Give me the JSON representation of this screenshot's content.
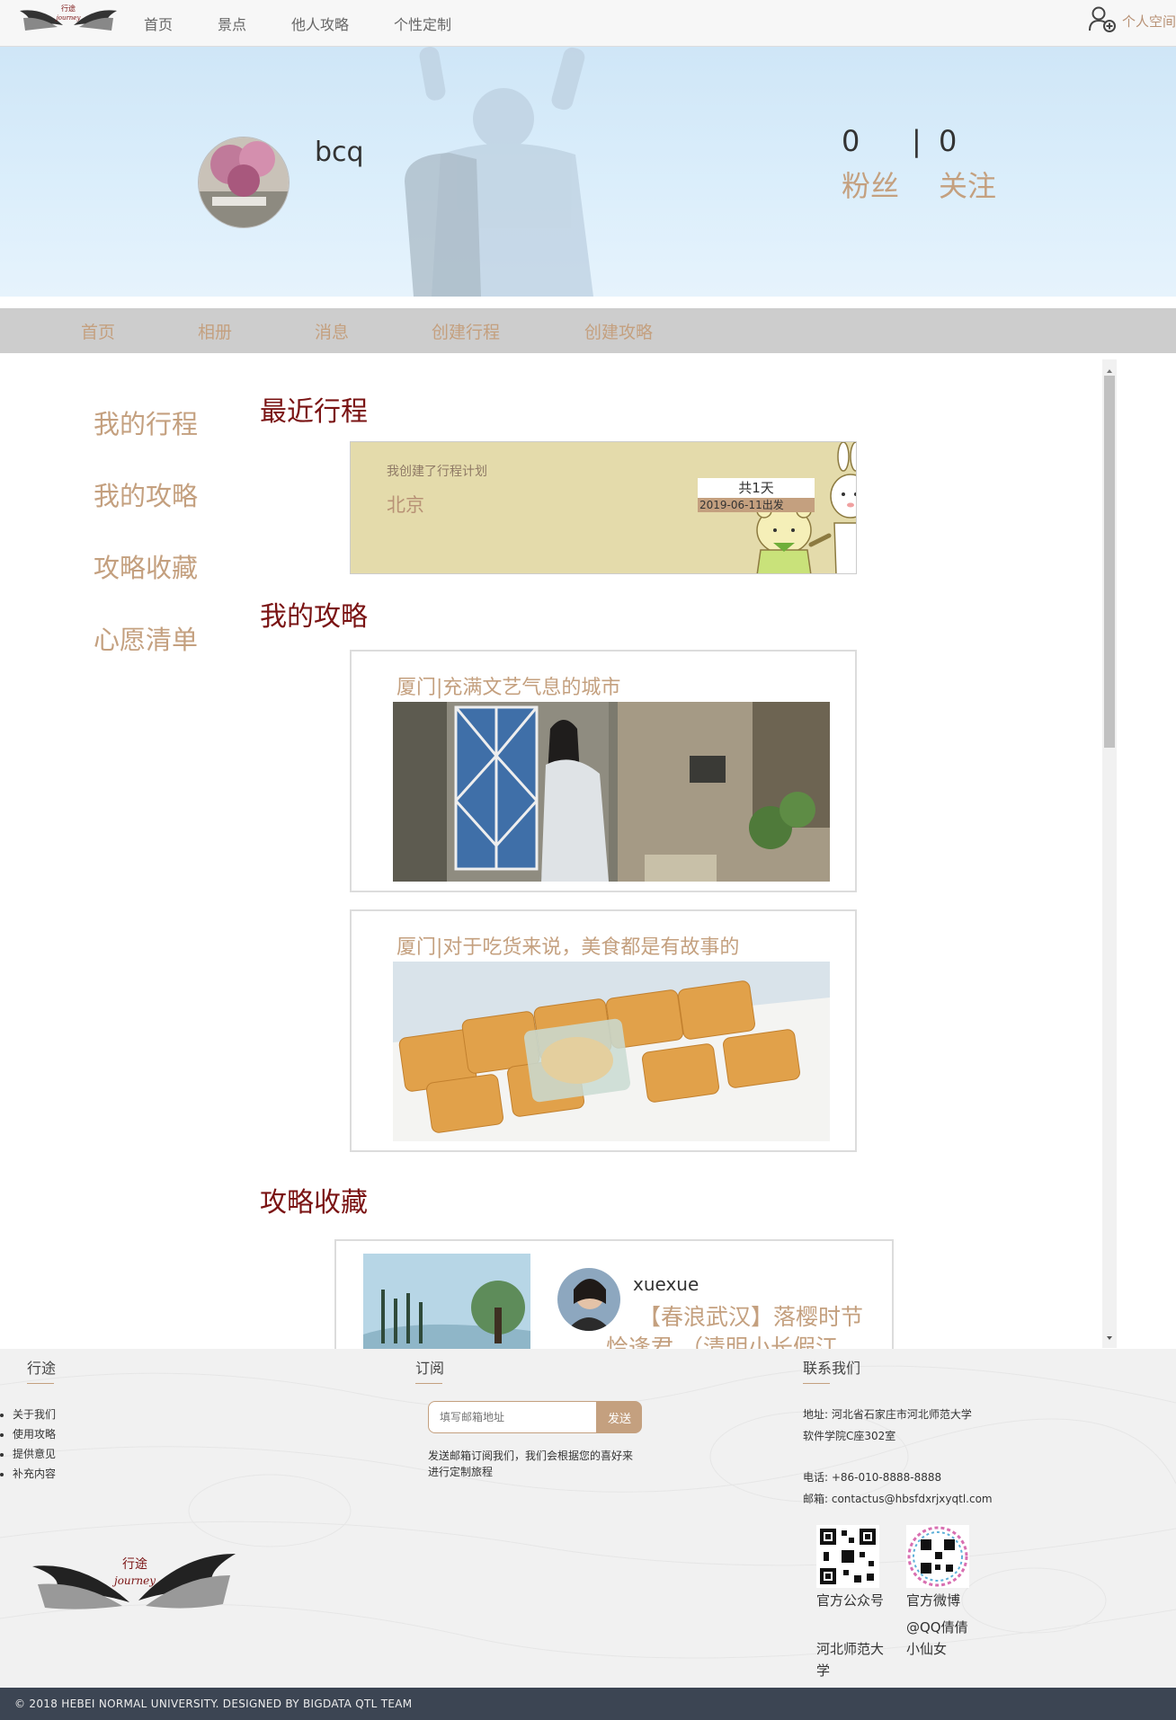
{
  "topnav": {
    "logo_text_cn": "行途",
    "logo_text_en": "journey",
    "links": [
      "首页",
      "景点",
      "他人攻略",
      "个性定制"
    ],
    "user_space": "个人空间"
  },
  "profile": {
    "username": "bcq",
    "fans_count": "0",
    "follow_count": "0",
    "separator": "|",
    "fans_label": "粉丝",
    "follow_label": "关注"
  },
  "subnav": [
    "首页",
    "相册",
    "消息",
    "创建行程",
    "创建攻略"
  ],
  "sidebar": [
    "我的行程",
    "我的攻略",
    "攻略收藏",
    "心愿清单"
  ],
  "sections": {
    "recent_trip": "最近行程",
    "my_guides": "我的攻略",
    "fav_guides": "攻略收藏"
  },
  "trip": {
    "subtitle": "我创建了行程计划",
    "city": "北京",
    "days": "共1天",
    "date": "2019-06-11出发"
  },
  "guides": [
    {
      "title": "厦门|充满文艺气息的城市"
    },
    {
      "title": "厦门|对于吃货来说，美食都是有故事的"
    }
  ],
  "favorite": {
    "user": "xuexue",
    "title": "【春浪武汉】落樱时节恰逢君 （清明小长假江"
  },
  "footer": {
    "col1_heading": "行途",
    "col1_links": [
      "关于我们",
      "使用攻略",
      "提供意见",
      "补充内容"
    ],
    "col2_heading": "订阅",
    "subscribe_placeholder": "填写邮箱地址",
    "subscribe_button": "发送",
    "subscribe_desc": "发送邮箱订阅我们，我们会根据您的喜好来进行定制旅程",
    "col3_heading": "联系我们",
    "address_line1": "地址: 河北省石家庄市河北师范大学",
    "address_line2": "软件学院C座302室",
    "phone": "电话: +86-010-8888-8888",
    "email": "邮箱: contactus@hbsfdxrjxyqtl.com",
    "qr1_caption": "官方公众号",
    "qr1_sub": "河北师范大学",
    "qr2_caption": "官方微博",
    "qr2_sub": "@QQ倩倩小仙女",
    "logo_cn": "行途",
    "logo_en": "journey"
  },
  "copyright": "© 2018 HEBEI NORMAL UNIVERSITY. DESIGNED BY BIGDATA QTL TEAM",
  "colors": {
    "accent": "#c4a07f",
    "heading": "#7a1313",
    "trip_card_bg": "#e4dbab",
    "banner_bg": "#d6ebf9",
    "footer_bar": "#3c4553"
  }
}
